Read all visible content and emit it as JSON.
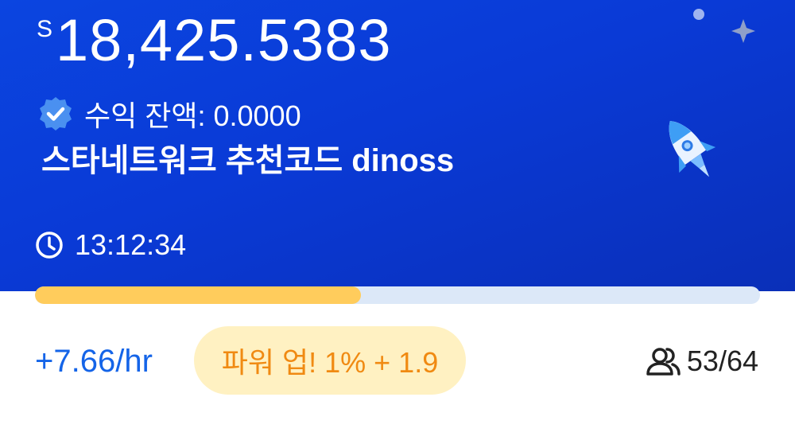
{
  "balance": {
    "currency_symbol": "S",
    "amount": "18,425.5383"
  },
  "earnings": {
    "label": "수익 잔액: 0.0000"
  },
  "referral": {
    "text": "스타네트워크 추천코드 dinoss"
  },
  "timer": {
    "value": "13:12:34"
  },
  "progress": {
    "fraction": 0.45
  },
  "rate": {
    "text": "+7.66/hr"
  },
  "powerup": {
    "text": "파워 업! 1% + 1.9"
  },
  "members": {
    "text": "53/64"
  },
  "icons": {
    "verified": "verified-badge-icon",
    "rocket": "rocket-icon",
    "clock": "clock-icon",
    "members": "users-icon",
    "sparkle": "sparkle-icon"
  },
  "colors": {
    "hero_blue": "#0a3ad6",
    "progress_fill": "#ffcc5c",
    "progress_track": "#dce8f8",
    "rate_text": "#1464e8",
    "powerup_bg": "#fff1c2",
    "powerup_text": "#f08a12"
  }
}
